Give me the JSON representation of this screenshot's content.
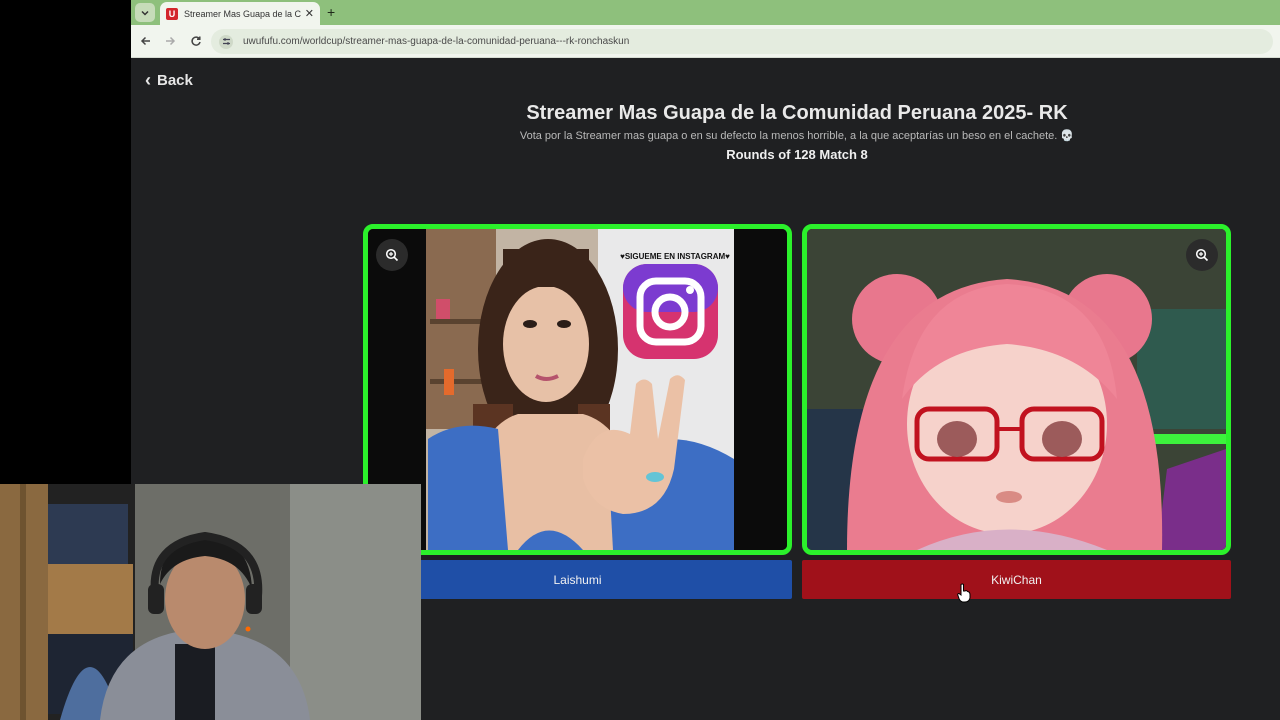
{
  "browser": {
    "tab_title": "Streamer Mas Guapa de la Comunidad Peruana 2025- RK",
    "favicon_letter": "U",
    "url": "uwufufu.com/worldcup/streamer-mas-guapa-de-la-comunidad-peruana---rk-ronchaskun"
  },
  "page": {
    "back_label": "Back",
    "title": "Streamer Mas Guapa de la Comunidad Peruana 2025- RK",
    "description": "Vota por la Streamer mas guapa o en su defecto la menos horrible, a la que aceptarías un beso en el cachete. 💀",
    "round_info": "Rounds of 128 Match 8"
  },
  "match": {
    "left": {
      "name": "Laishumi",
      "overlay_text": "♥SIGUEME EN INSTAGRAM♥",
      "button_color": "#1f4fa7"
    },
    "right": {
      "name": "KiwiChan",
      "button_color": "#a0111a"
    },
    "highlight_color": "#2bf12b"
  },
  "icons": [
    "chevron-down-icon",
    "close-icon",
    "plus-icon",
    "arrow-left-icon",
    "arrow-right-icon",
    "reload-icon",
    "site-info-icon",
    "zoom-in-icon",
    "hand-cursor-icon",
    "instagram-logo"
  ]
}
